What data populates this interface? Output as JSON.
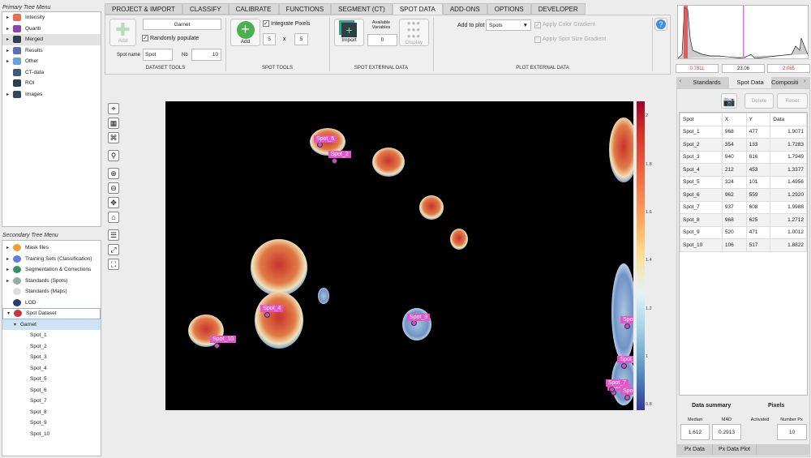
{
  "primary_tree": {
    "title": "Primary Tree Menu",
    "items": [
      {
        "label": "Intensity",
        "expandable": true,
        "color": "#e76f51"
      },
      {
        "label": "Quanti",
        "expandable": true,
        "color": "#8e44ad"
      },
      {
        "label": "Merged",
        "expandable": true,
        "color": "#2c3e50",
        "selected": true
      },
      {
        "label": "Results",
        "expandable": true,
        "color": "#5b6fb5"
      },
      {
        "label": "Other",
        "expandable": true,
        "color": "#6aa3d8"
      },
      {
        "label": "CT-data",
        "expandable": false,
        "color": "#3d5a80"
      },
      {
        "label": "ROI",
        "expandable": false,
        "color": "#2c3e50"
      },
      {
        "label": "Images",
        "expandable": true,
        "color": "#34495e"
      }
    ]
  },
  "secondary_tree": {
    "title": "Secondary Tree Menu",
    "items": [
      {
        "label": "Mask files",
        "color": "#f0a030",
        "tri": "▸"
      },
      {
        "label": "Training Sets (Classification)",
        "color": "#5b7fd8",
        "tri": "▸"
      },
      {
        "label": "Segmentation & Corrections",
        "color": "#3a8f6a",
        "tri": "▸"
      },
      {
        "label": "Standards (Spots)",
        "color": "#9aa",
        "tri": "▸"
      },
      {
        "label": "Standards (Maps)",
        "color": "#ddd",
        "tri": ""
      },
      {
        "label": "LOD",
        "color": "#2c3e70",
        "tri": ""
      },
      {
        "label": "Spot Dataset",
        "color": "#d0303a",
        "tri": "▾"
      },
      {
        "label": "Garnet",
        "color": "",
        "tri": "▾"
      }
    ],
    "spots": [
      "Spot_1",
      "Spot_2",
      "Spot_3",
      "Spot_4",
      "Spot_5",
      "Spot_6",
      "Spot_7",
      "Spot_8",
      "Spot_9",
      "Spot_10"
    ]
  },
  "ribbon": {
    "tabs": [
      "PROJECT & IMPORT",
      "CLASSIFY",
      "CALIBRATE",
      "FUNCTIONS",
      "SEGMENT (CT)",
      "SPOT DATA",
      "ADD-ONS",
      "OPTIONS",
      "DEVELOPER"
    ],
    "active": "SPOT DATA",
    "dataset_tools": {
      "add": "Add",
      "name": "Garnet",
      "randomly": "Randomly populate",
      "spot_name_label": "Spot name",
      "spot_name": "Spot",
      "nb_label": "Nb",
      "nb": "10",
      "group": "DATASET TOOLS"
    },
    "spot_tools": {
      "add": "Add",
      "integrate": "Integrate Pixels",
      "w": "5",
      "x": "x",
      "h": "5",
      "group": "SPOT TOOLS"
    },
    "spot_external": {
      "import": "Import",
      "avail_label": "Available Variables",
      "avail": "0",
      "display": "Display",
      "group": "SPOT EXTERNAL DATA"
    },
    "plot_external": {
      "add_to_plot": "Add to plot",
      "select": "Spots",
      "color_gradient": "Apply Color Gradient",
      "size_gradient": "Apply Spot Size Gradient",
      "group": "PLOT EXTERNAL DATA"
    },
    "help": "?"
  },
  "colorbar": {
    "ticks": [
      "2",
      "1.8",
      "1.6",
      "1.4",
      "1.2",
      "1",
      "0.8"
    ]
  },
  "histogram": {
    "min": "0.7811",
    "mid": "23.06",
    "max": "2.065"
  },
  "right_tabs": [
    "Standards",
    "Spot Data",
    "Compositi"
  ],
  "spot_panel": {
    "delete": "Delete",
    "reset": "Reset",
    "headers": [
      "Spot",
      "X",
      "Y",
      "Data"
    ],
    "rows": [
      [
        "Spot_1",
        "968",
        "477",
        "1.9071"
      ],
      [
        "Spot_2",
        "354",
        "133",
        "1.7283"
      ],
      [
        "Spot_3",
        "940",
        "616",
        "1.7949"
      ],
      [
        "Spot_4",
        "212",
        "453",
        "1.3377"
      ],
      [
        "Spot_5",
        "324",
        "101",
        "1.4956"
      ],
      [
        "Spot_6",
        "962",
        "559",
        "1.2920"
      ],
      [
        "Spot_7",
        "937",
        "608",
        "1.9988"
      ],
      [
        "Spot_8",
        "968",
        "625",
        "1.2712"
      ],
      [
        "Spot_9",
        "520",
        "471",
        "1.0012"
      ],
      [
        "Spot_10",
        "106",
        "517",
        "1.8822"
      ]
    ],
    "summary_title": "Data summary",
    "pixels_title": "Pixels",
    "median_label": "Median",
    "median": "1.612",
    "mad_label": "MAD",
    "mad": "0.2913",
    "activated_label": "Activated",
    "numpx_label": "Number Px",
    "numpx": "10"
  },
  "bottom_tabs": [
    "Px Data",
    "Px Data Plot"
  ]
}
